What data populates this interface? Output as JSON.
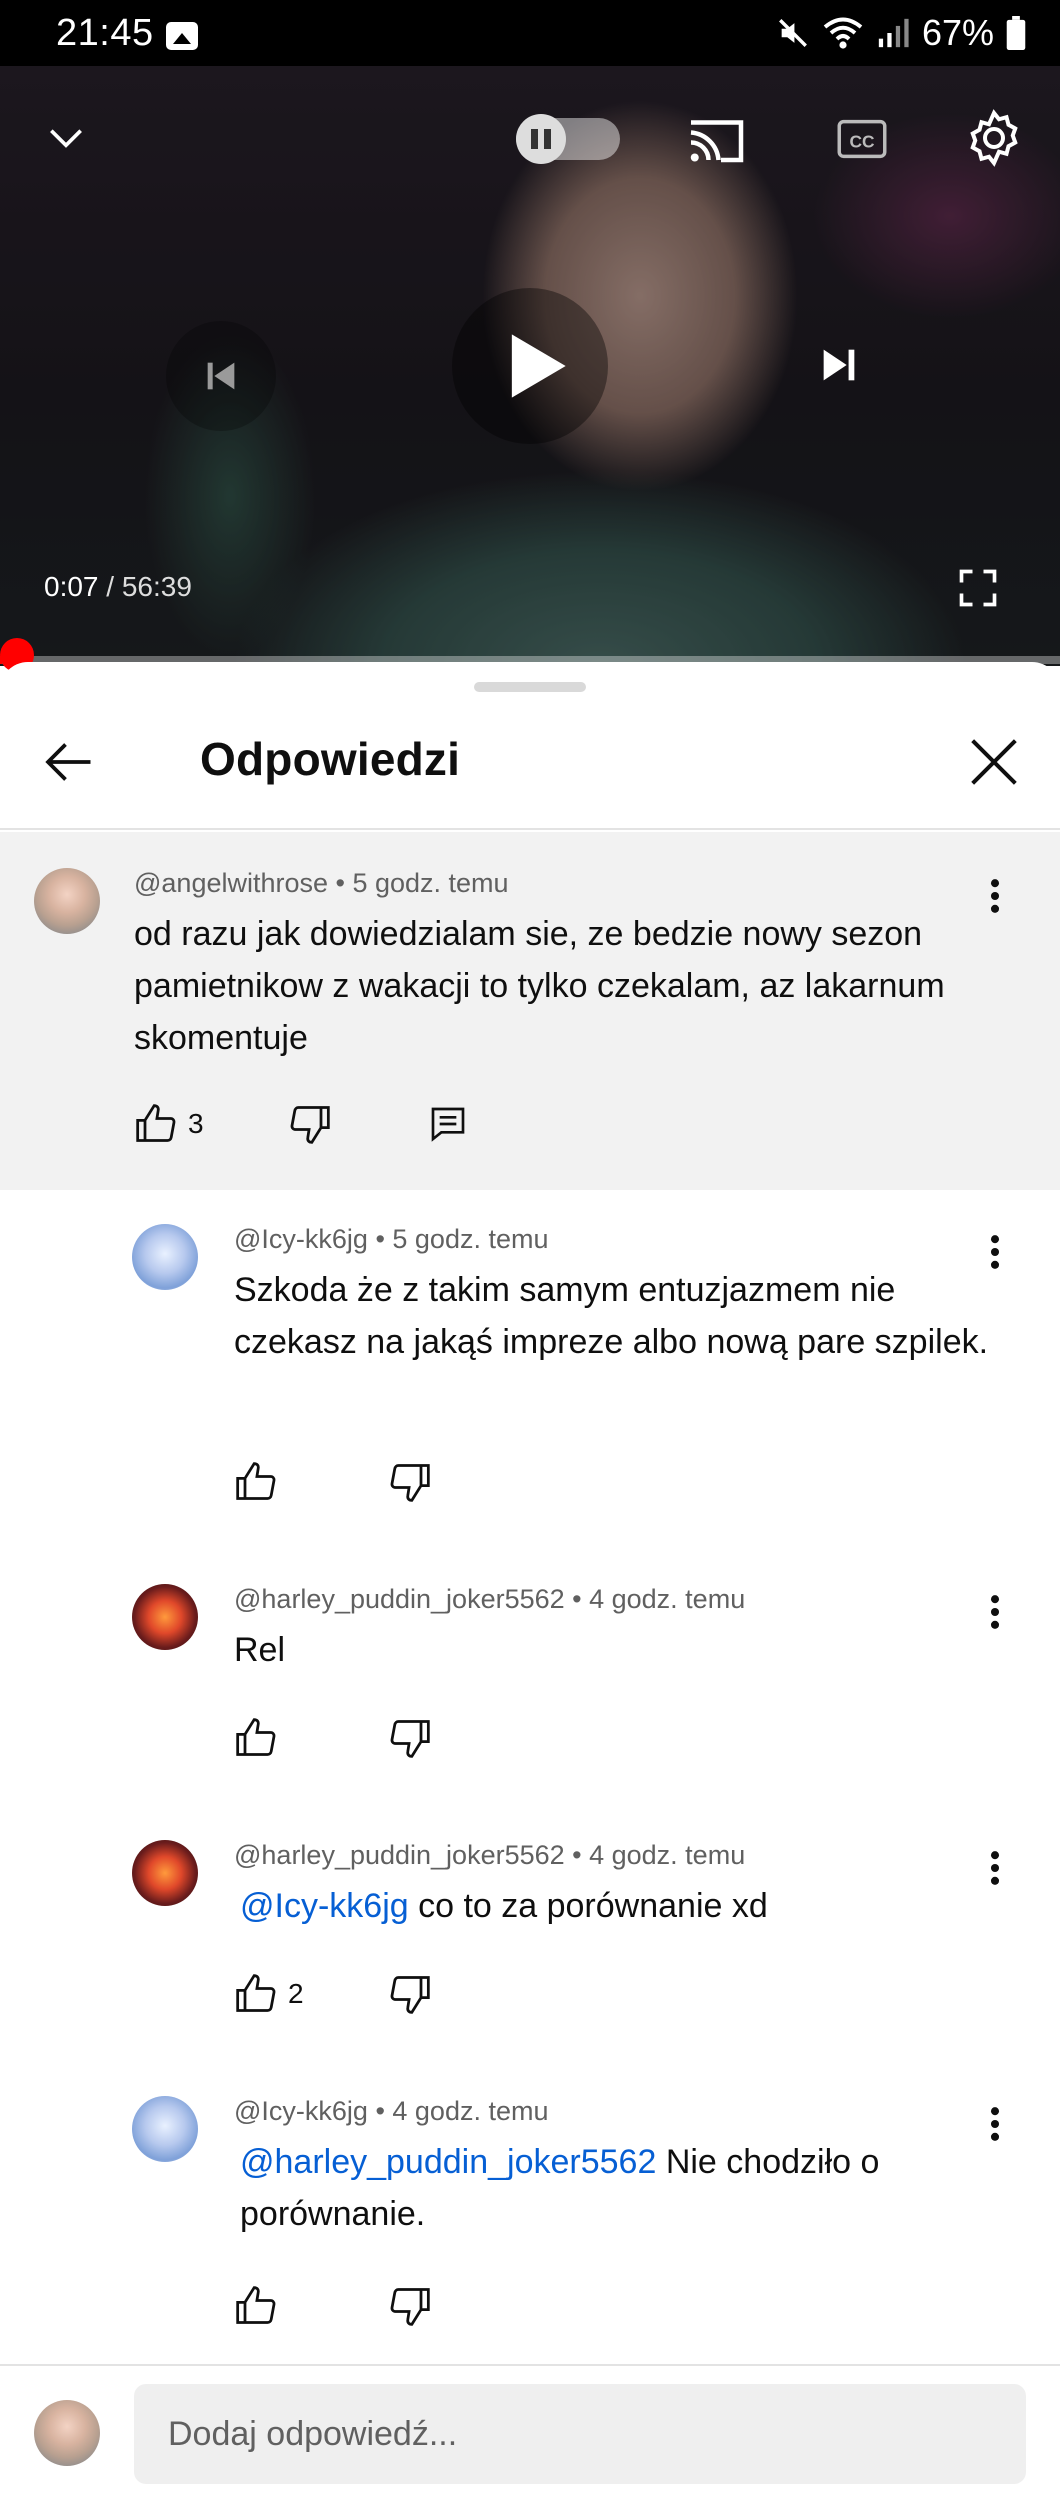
{
  "status_bar": {
    "time": "21:45",
    "battery": "67%",
    "icons": [
      "gallery-icon",
      "mute-icon",
      "wifi-icon",
      "signal-icon",
      "battery-icon"
    ]
  },
  "player": {
    "current_time": "0:07",
    "duration": " / 56:39",
    "progress_fraction": 0.002,
    "icons": [
      "chevron-down-icon",
      "autoplay-toggle",
      "cast-icon",
      "captions-icon",
      "settings-icon",
      "previous-icon",
      "play-icon",
      "next-icon",
      "fullscreen-icon"
    ]
  },
  "sheet": {
    "title": "Odpowiedzi"
  },
  "parent_comment": {
    "author": "@angelwithrose",
    "time": " • 5 godz. temu",
    "text": "od razu jak dowiedzialam sie, ze bedzie nowy sezon pamietnikow z wakacji to tylko czekalam, az lakarnum skomentuje",
    "likes": "3"
  },
  "replies": [
    {
      "author": "@Icy-kk6jg",
      "time": " • 5 godz. temu",
      "mention": "",
      "text": "Szkoda że z takim samym entuzjazmem nie czekasz na jakąś impreze albo nową pare szpilek.",
      "likes": ""
    },
    {
      "author": "@harley_puddin_joker5562",
      "time": " • 4 godz. temu",
      "mention": "",
      "text": "Rel",
      "likes": ""
    },
    {
      "author": "@harley_puddin_joker5562",
      "time": " • 4 godz. temu",
      "mention": "@Icy-kk6jg",
      "text": " co to za porównanie xd",
      "likes": "2"
    },
    {
      "author": "@Icy-kk6jg",
      "time": " • 4 godz. temu",
      "mention": "@harley_puddin_joker5562",
      "text": "  Nie chodziło o porównanie.",
      "likes": ""
    }
  ],
  "reply_bar": {
    "placeholder": "Dodaj odpowiedź..."
  },
  "colors": {
    "accent_red": "#ff0000",
    "mention_blue": "#065fd4",
    "parent_bg": "#f2f2f2"
  }
}
